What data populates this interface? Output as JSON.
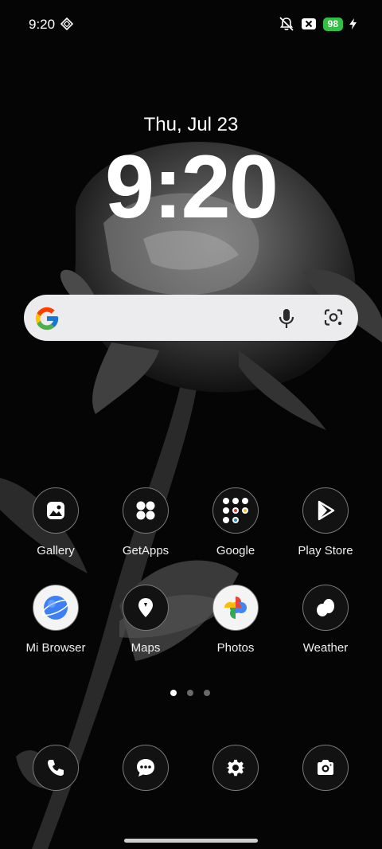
{
  "status": {
    "time": "9:20",
    "battery": "98"
  },
  "lockscreen": {
    "date": "Thu, Jul 23",
    "clock": "9:20"
  },
  "search": {
    "google_icon": "google-g-icon",
    "mic_icon": "mic-icon",
    "lens_icon": "lens-icon"
  },
  "apps": [
    {
      "label": "Gallery",
      "icon": "gallery-icon"
    },
    {
      "label": "GetApps",
      "icon": "getapps-icon"
    },
    {
      "label": "Google",
      "icon": "google-folder-icon"
    },
    {
      "label": "Play Store",
      "icon": "play-store-icon"
    },
    {
      "label": "Mi Browser",
      "icon": "mi-browser-icon"
    },
    {
      "label": "Maps",
      "icon": "maps-icon"
    },
    {
      "label": "Photos",
      "icon": "photos-icon"
    },
    {
      "label": "Weather",
      "icon": "weather-icon"
    }
  ],
  "dock": [
    {
      "icon": "phone-icon"
    },
    {
      "icon": "messages-icon"
    },
    {
      "icon": "settings-icon"
    },
    {
      "icon": "camera-icon"
    }
  ],
  "pager": {
    "pages": 3,
    "current": 1
  },
  "colors": {
    "battery": "#31c042",
    "search_bg": "#ececee"
  }
}
